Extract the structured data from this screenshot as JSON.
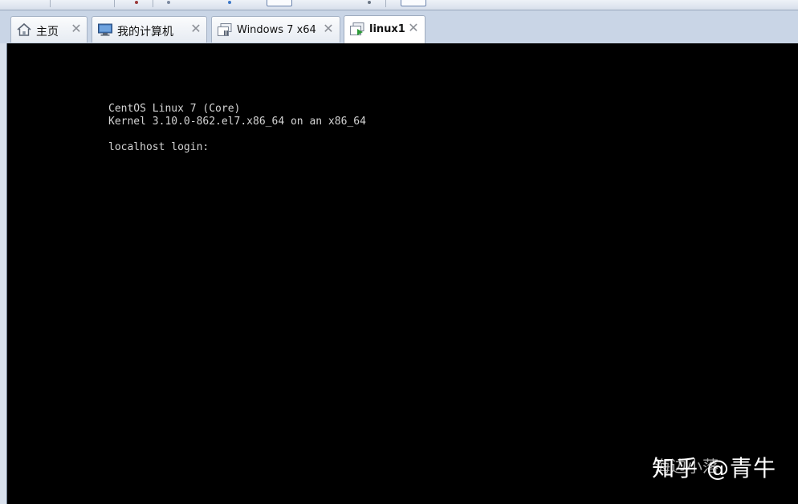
{
  "tabs": [
    {
      "label": "主页",
      "icon": "home-icon",
      "active": false
    },
    {
      "label": "我的计算机",
      "icon": "computer-icon",
      "active": false
    },
    {
      "label": "Windows 7 x64",
      "icon": "vm-icon",
      "active": false
    },
    {
      "label": "linux1",
      "icon": "vm-running-icon",
      "active": true
    }
  ],
  "close_glyph": "✕",
  "console": {
    "lines": [
      "CentOS Linux 7 (Core)",
      "Kernel 3.10.0-862.el7.x86_64 on an x86_64",
      "",
      "localhost login: "
    ]
  },
  "watermark": {
    "text": "知乎 @青牛",
    "ghost_text": "海边小落"
  },
  "colors": {
    "console_bg": "#000000",
    "console_fg": "#d4d4d4",
    "tabbar_bg": "#c9d5e6",
    "vm_running_green": "#2e9b3a"
  }
}
